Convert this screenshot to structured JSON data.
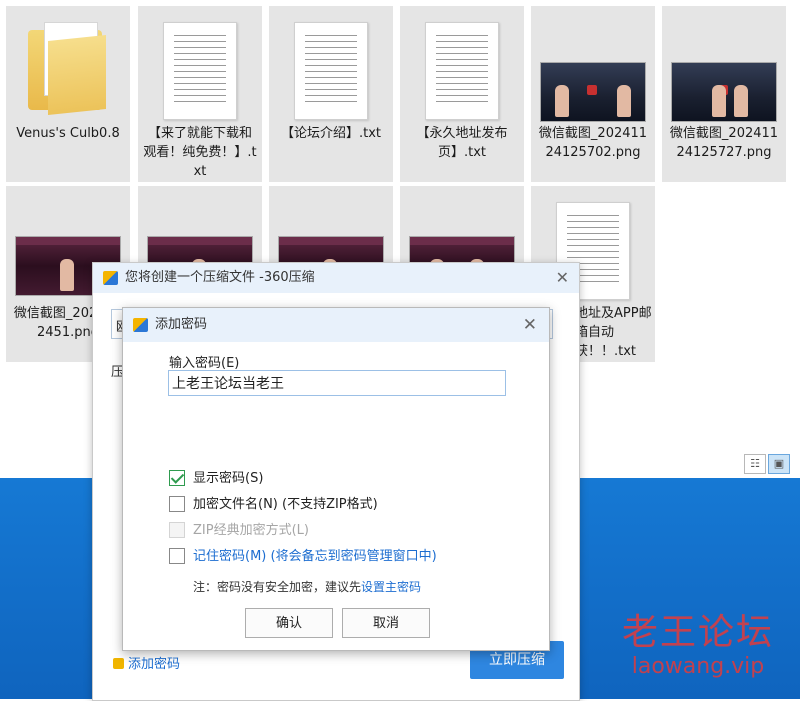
{
  "files": [
    {
      "label": "Venus's Culb0.8",
      "icon": "folder-icon"
    },
    {
      "label": "【来了就能下载和观看！纯免费！】.txt",
      "icon": "text-file-icon"
    },
    {
      "label": "【论坛介绍】.txt",
      "icon": "text-file-icon"
    },
    {
      "label": "【永久地址发布页】.txt",
      "icon": "text-file-icon"
    },
    {
      "label": "微信截图_20241124125702.png",
      "icon": "image-file-icon"
    },
    {
      "label": "微信截图_20241124125727.png",
      "icon": "image-file-icon"
    },
    {
      "label": "微信截图_2024112451.png",
      "icon": "image-file-icon"
    },
    {
      "label": "",
      "icon": "image-file-icon"
    },
    {
      "label": "",
      "icon": "image-file-icon"
    },
    {
      "label": "",
      "icon": "image-file-icon"
    },
    {
      "label": "地址及APP邮箱自动获！！.txt",
      "icon": "text-file-icon"
    }
  ],
  "main_dialog": {
    "title": "您将创建一个压缩文件 -360压缩",
    "close": "✕",
    "input_value": "欧",
    "label": "压",
    "add_password_link": "添加密码",
    "compress_button": "立即压缩"
  },
  "password_dialog": {
    "title": "添加密码",
    "close": "✕",
    "input_label": "输入密码(E)",
    "password_value": "上老王论坛当老王",
    "options": [
      {
        "label": "显示密码(S)",
        "checked": true,
        "disabled": false
      },
      {
        "label": "加密文件名(N) (不支持ZIP格式)",
        "checked": false,
        "disabled": false
      },
      {
        "label": "ZIP经典加密方式(L)",
        "checked": false,
        "disabled": true
      },
      {
        "label": "记住密码(M) (将会备忘到密码管理窗口中)",
        "checked": false,
        "disabled": false
      }
    ],
    "note_prefix": "注：密码没有安全加密，建议先",
    "note_link": "设置主密码",
    "ok_button": "确认",
    "cancel_button": "取消"
  },
  "watermark": {
    "line1": "老王论坛",
    "line2": "laowang.vip"
  },
  "view_icons": {
    "details": "☷",
    "large": "▣"
  }
}
